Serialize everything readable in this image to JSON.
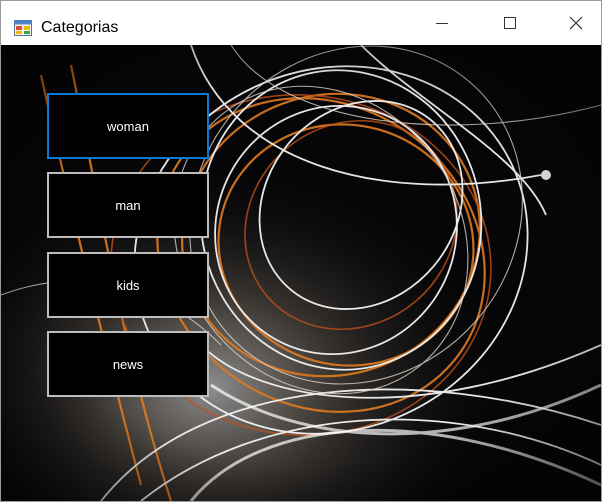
{
  "window": {
    "title": "Categorias",
    "controls": {
      "minimize_icon": "minimize-icon",
      "maximize_icon": "maximize-icon",
      "close_icon": "close-icon"
    }
  },
  "categories": [
    {
      "label": "woman",
      "focused": true
    },
    {
      "label": "man",
      "focused": false
    },
    {
      "label": "kids",
      "focused": false
    },
    {
      "label": "news",
      "focused": false
    }
  ],
  "colors": {
    "button_bg": "#000000",
    "button_border": "#bdbdbd",
    "focus_border": "#0a78d7",
    "button_text": "#ffffff",
    "background": "#050507"
  }
}
